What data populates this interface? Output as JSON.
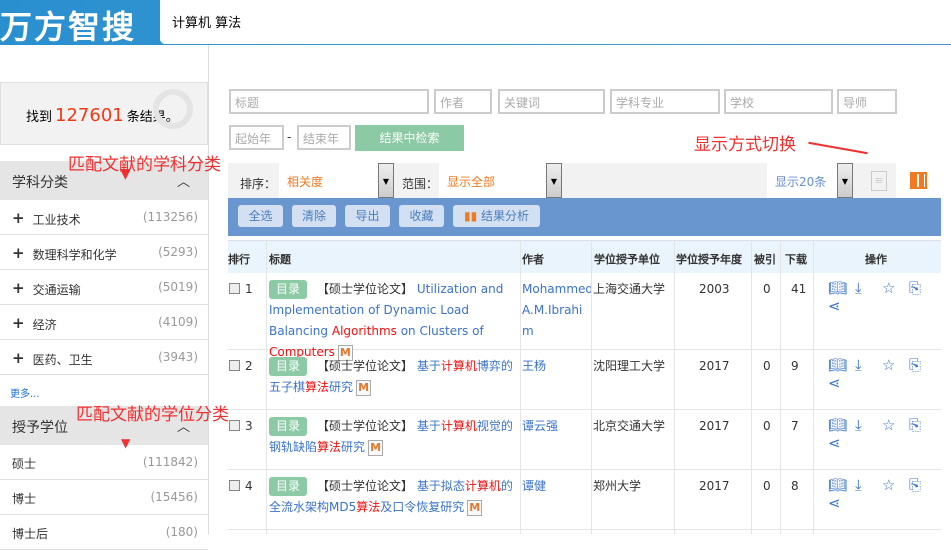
{
  "header": {
    "logo": "万方智搜",
    "query": "计算机 算法"
  },
  "sidebar": {
    "found_prefix": "找到",
    "found_count": "127601",
    "found_suffix": "条结果。",
    "subject_title": "学科分类",
    "subjects": [
      {
        "label": "工业技术",
        "count": "(113256)"
      },
      {
        "label": "数理科学和化学",
        "count": "(5293)"
      },
      {
        "label": "交通运输",
        "count": "(5019)"
      },
      {
        "label": "经济",
        "count": "(4109)"
      },
      {
        "label": "医药、卫生",
        "count": "(3943)"
      }
    ],
    "more": "更多...",
    "degree_title": "授予学位",
    "degrees": [
      {
        "label": "硕士",
        "count": "(111842)"
      },
      {
        "label": "博士",
        "count": "(15456)"
      },
      {
        "label": "博士后",
        "count": "(180)"
      }
    ]
  },
  "annotations": {
    "subject": "匹配文献的学科分类",
    "degree": "匹配文献的学位分类",
    "display": "显示方式切换"
  },
  "filters": {
    "title": "标题",
    "author": "作者",
    "keyword": "关键词",
    "major": "学科专业",
    "school": "学校",
    "advisor": "导师",
    "start_year": "起始年",
    "end_year": "结束年",
    "dash": "-",
    "search_in": "结果中检索"
  },
  "sortbar": {
    "sort_label": "排序：",
    "sort_value": "相关度",
    "range_label": "范围：",
    "range_value": "显示全部",
    "page_size": "显示20条"
  },
  "toolbar": {
    "select_all": "全选",
    "clear": "清除",
    "export": "导出",
    "favorite": "收藏",
    "analysis": "结果分析"
  },
  "table": {
    "headers": [
      "排行",
      "标题",
      "作者",
      "学位授予单位",
      "学位授予年度",
      "被引",
      "下载",
      "操作"
    ],
    "tag": "目录",
    "type": "【硕士学位论文】",
    "m": "M",
    "rows": [
      {
        "rank": "1",
        "title": [
          [
            "Utilization and Implementation of Dynamic Load Balancing ",
            "b"
          ],
          [
            "Algorithms",
            "r"
          ],
          [
            " on Clusters of ",
            "b"
          ],
          [
            "Computers",
            "r"
          ]
        ],
        "author": "Mohammed A.M.Ibrahim",
        "unit": "上海交通大学",
        "year": "2003",
        "cited": "0",
        "downloads": "41"
      },
      {
        "rank": "2",
        "title": [
          [
            "基于",
            "b"
          ],
          [
            "计算机",
            "r"
          ],
          [
            "博弈的五子棋",
            "b"
          ],
          [
            "算法",
            "r"
          ],
          [
            "研究",
            "b"
          ]
        ],
        "author": "王杨",
        "unit": "沈阳理工大学",
        "year": "2017",
        "cited": "0",
        "downloads": "9"
      },
      {
        "rank": "3",
        "title": [
          [
            "基于",
            "b"
          ],
          [
            "计算机",
            "r"
          ],
          [
            "视觉的钢轨缺陷",
            "b"
          ],
          [
            "算法",
            "r"
          ],
          [
            "研究",
            "b"
          ]
        ],
        "author": "谭云强",
        "unit": "北京交通大学",
        "year": "2017",
        "cited": "0",
        "downloads": "7"
      },
      {
        "rank": "4",
        "title": [
          [
            "基于拟态",
            "b"
          ],
          [
            "计算机",
            "r"
          ],
          [
            "的全流水架构MD5",
            "b"
          ],
          [
            "算法",
            "r"
          ],
          [
            "及口令恢复研究",
            "b"
          ]
        ],
        "author": "谭健",
        "unit": "郑州大学",
        "year": "2017",
        "cited": "0",
        "downloads": "8"
      }
    ]
  }
}
